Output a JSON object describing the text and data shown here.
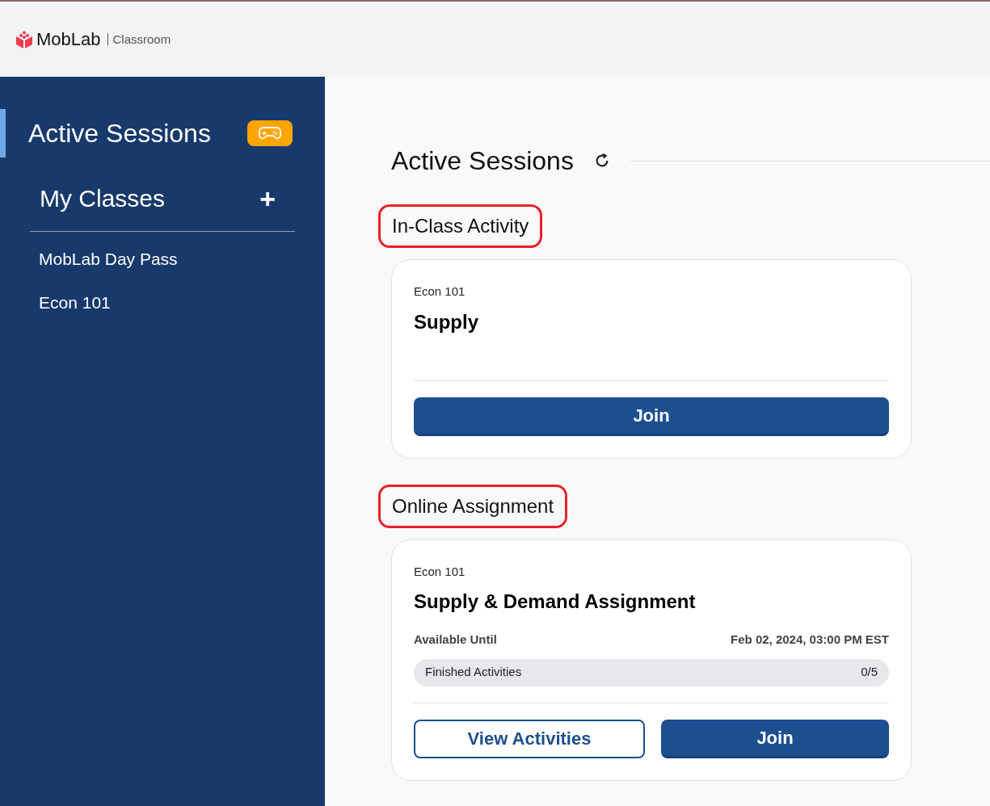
{
  "header": {
    "brand": "MobLab",
    "product": "Classroom"
  },
  "sidebar": {
    "nav": [
      {
        "label": "Active Sessions",
        "selected": true
      }
    ],
    "classes_title": "My Classes",
    "add_symbol": "+",
    "classes": [
      {
        "label": "MobLab Day Pass"
      },
      {
        "label": "Econ 101"
      }
    ]
  },
  "main": {
    "title": "Active Sessions",
    "sections": [
      {
        "heading": "In-Class Activity",
        "highlighted": true,
        "cards": [
          {
            "kind": "in_class",
            "course": "Econ 101",
            "title": "Supply",
            "buttons": [
              {
                "label": "Join",
                "kind": "primary"
              }
            ]
          }
        ]
      },
      {
        "heading": "Online Assignment",
        "highlighted": true,
        "cards": [
          {
            "kind": "assignment",
            "course": "Econ 101",
            "title": "Supply & Demand Assignment",
            "due_label": "Available Until",
            "due_value": "Feb 02, 2024, 03:00 PM EST",
            "progress": {
              "label": "Finished Activities",
              "reading": "0/5",
              "level": 0
            },
            "buttons": [
              {
                "label": "View Activities",
                "kind": "outline"
              },
              {
                "label": "Join",
                "kind": "primary"
              }
            ]
          }
        ]
      }
    ]
  }
}
